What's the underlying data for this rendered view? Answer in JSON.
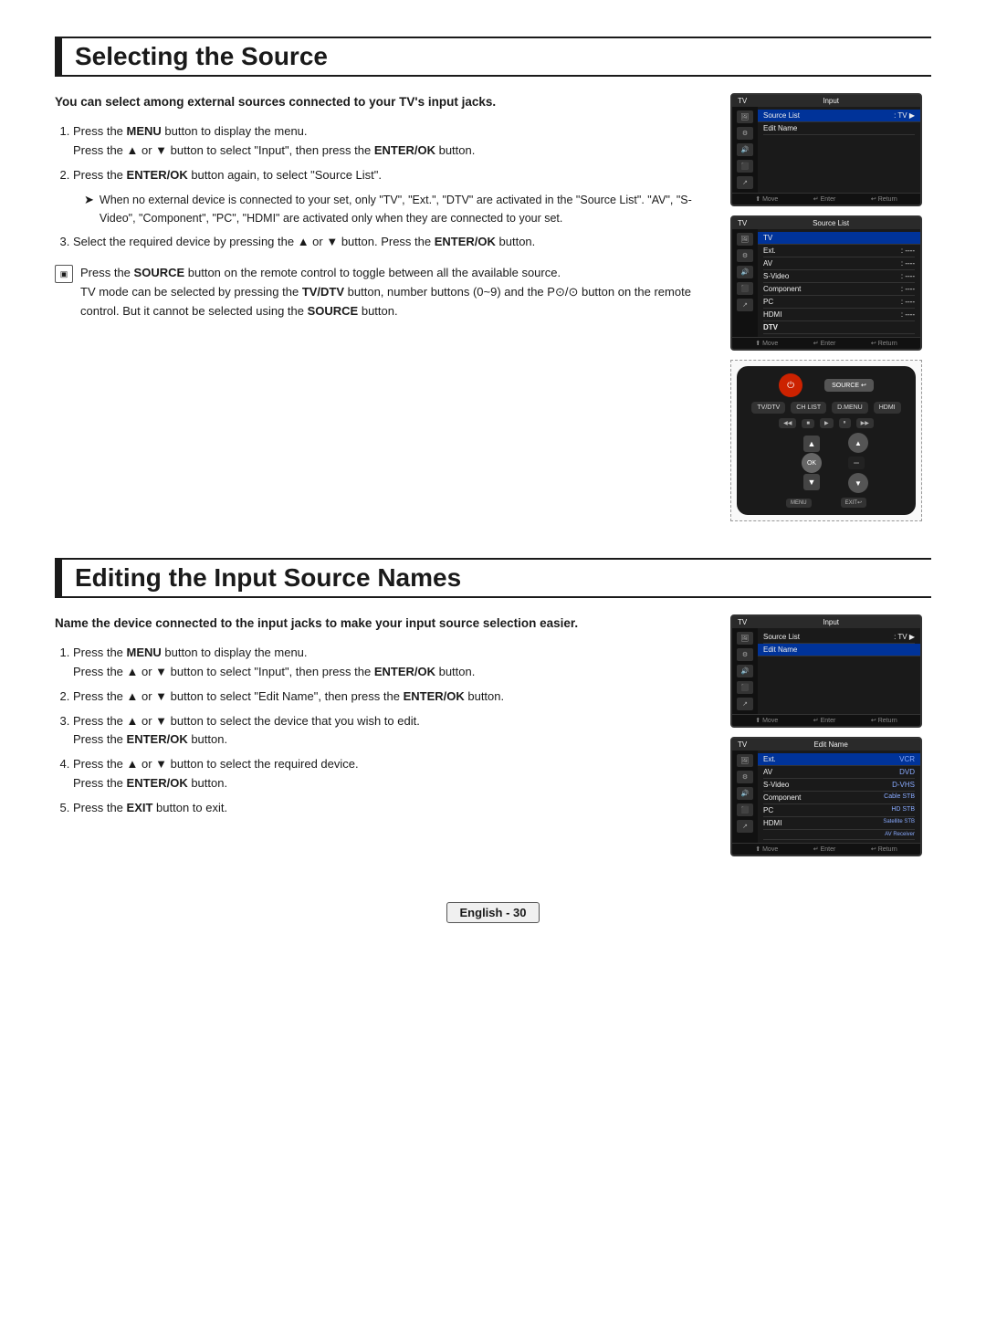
{
  "page": {
    "sections": [
      {
        "id": "selecting-source",
        "heading": "Selecting the Source",
        "intro": "You can select among external sources connected to your TV's input jacks.",
        "steps": [
          {
            "num": 1,
            "text": "Press the <b>MENU</b> button to display the menu.\nPress the ▲ or ▼ button to select \"Input\", then press the <b>ENTER/OK</b> button."
          },
          {
            "num": 2,
            "text": "Press the <b>ENTER/OK</b> button again, to select \"Source List\".",
            "note": "When no external device is connected to your set, only \"TV\", \"Ext.\", \"DTV\" are activated in the \"Source List\". \"AV\", \"S-Video\", \"Component\", \"PC\", \"HDMI\" are activated only when they are connected to your set."
          },
          {
            "num": 3,
            "text": "Select the required device by pressing the ▲ or ▼ button. Press the <b>ENTER/OK</b> button."
          }
        ],
        "source_note": "Press the <b>SOURCE</b> button on the remote control to toggle between all the available source.\nTV mode can be selected by pressing the <b>TV/DTV</b> button, number buttons (0~9) and the P⊙/⊙ button on the remote control. But it cannot be selected using the <b>SOURCE</b> button."
      },
      {
        "id": "editing-input-names",
        "heading": "Editing the Input Source Names",
        "intro": "Name the device connected to the input jacks to make your input source selection easier.",
        "steps": [
          {
            "num": 1,
            "text": "Press the <b>MENU</b> button to display the menu.\nPress the ▲ or ▼ button to select \"Input\", then press the <b>ENTER/OK</b> button."
          },
          {
            "num": 2,
            "text": "Press the ▲ or ▼ button to select \"Edit Name\", then press the <b>ENTER/OK</b> button."
          },
          {
            "num": 3,
            "text": "Press the ▲ or ▼ button to select the device that you wish to edit.\nPress the <b>ENTER/OK</b> button."
          },
          {
            "num": 4,
            "text": "Press the ▲ or ▼ button to select the required device.\nPress the <b>ENTER/OK</b> button."
          },
          {
            "num": 5,
            "text": "Press the <b>EXIT</b> button to exit."
          }
        ]
      }
    ],
    "footer": {
      "label": "English - 30"
    }
  }
}
